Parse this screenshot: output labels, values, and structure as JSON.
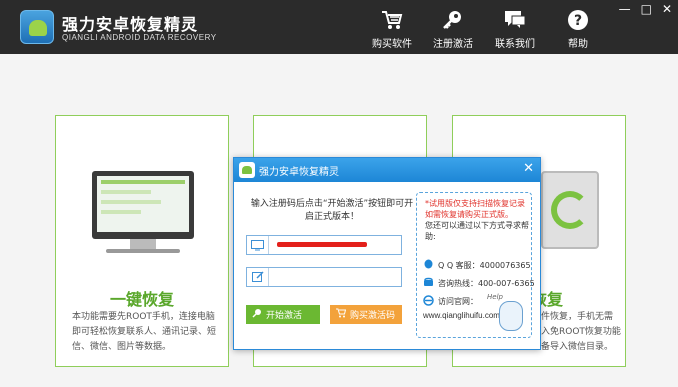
{
  "app": {
    "title": "强力安卓恢复精灵",
    "subtitle": "QIANGLI ANDROID DATA RECOVERY"
  },
  "nav": [
    {
      "label": "购买软件",
      "icon": "cart-icon"
    },
    {
      "label": "注册激活",
      "icon": "key-icon"
    },
    {
      "label": "联系我们",
      "icon": "chat-icon"
    },
    {
      "label": "帮助",
      "icon": "question-icon"
    }
  ],
  "window": {
    "minimize": "—",
    "maximize": "□",
    "close": "✕"
  },
  "cards": [
    {
      "title": "一键恢复",
      "desc": "本功能需要先ROOT手机，连接电脑即可轻松恢复联系人、通讯记录、短信、微信、图片等数据。"
    },
    {
      "title": "",
      "desc": ""
    },
    {
      "title": "恢复",
      "desc": "件恢复，手机无需入免ROOT恢复功能备导入微信目录。"
    }
  ],
  "dialog": {
    "title": "强力安卓恢复精灵",
    "close": "✕",
    "instruction": "输入注册码后点击“开始激活”按钮即可开启正式版本！",
    "code_value": "",
    "email_placeholder": "",
    "activate_label": "开始激活",
    "buy_label": "购买激活码",
    "note_red": "*试用版仅支持扫描恢复记录如需恢复请购买正式版。",
    "note": "您还可以通过以下方式寻求帮助:",
    "qq": "Q Q 客服：4000076365",
    "phone": "咨询热线：400-007-6365",
    "site": "访问官网：",
    "url": "www.qianglihuifu.com",
    "help": "Help"
  },
  "colors": {
    "header_bg": "#2b2b2b",
    "accent_green": "#6bb832",
    "accent_blue": "#1d86d6",
    "accent_orange": "#f3a23b"
  }
}
